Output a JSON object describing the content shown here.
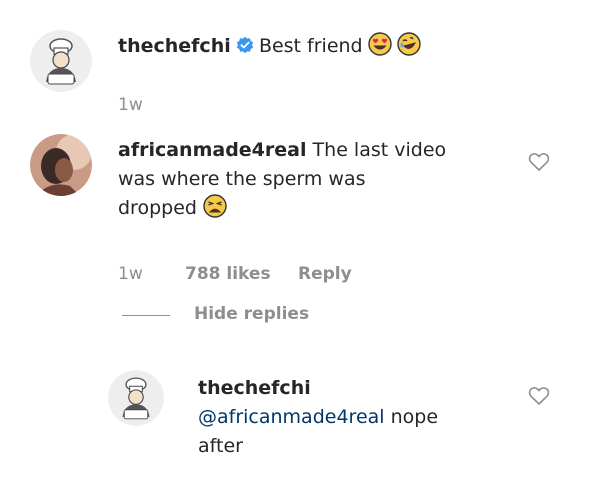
{
  "comments": [
    {
      "username": "thechefchi",
      "verified": true,
      "text": "Best friend",
      "emojis": [
        "heart-eyes-emoji",
        "rolling-laughing-emoji"
      ],
      "time": "1w"
    },
    {
      "username": "africanmade4real",
      "text_line1": "The last video",
      "text_line2": "was where the sperm was",
      "text_line3": "dropped",
      "emoji": "tired-face-emoji",
      "time": "1w",
      "likes": "788 likes",
      "reply_label": "Reply",
      "hide_replies_label": "Hide replies"
    }
  ],
  "reply": {
    "username": "thechefchi",
    "mention": "@africanmade4real",
    "text_line1": "nope",
    "text_line2": "after"
  },
  "icons": {
    "like": "heart-outline-icon",
    "verified": "verified-badge-icon"
  },
  "colors": {
    "text": "#262626",
    "secondary": "#8e8e8e",
    "mention": "#00376b",
    "verified": "#3897f0"
  }
}
